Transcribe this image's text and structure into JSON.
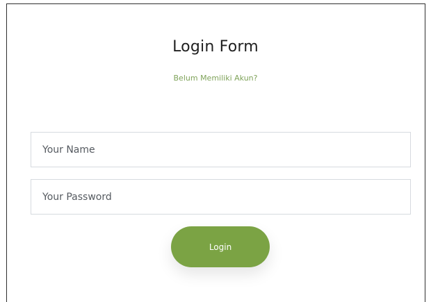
{
  "form": {
    "title": "Login Form",
    "signup_link": "Belum Memiliki Akun?",
    "name_field": {
      "placeholder": "Your Name",
      "value": ""
    },
    "password_field": {
      "placeholder": "Your Password",
      "value": ""
    },
    "login_button": "Login"
  },
  "colors": {
    "accent": "#7ba344",
    "link": "#7fa35a",
    "field_border": "#d6dadf",
    "frame_border": "#2e2e2e"
  }
}
